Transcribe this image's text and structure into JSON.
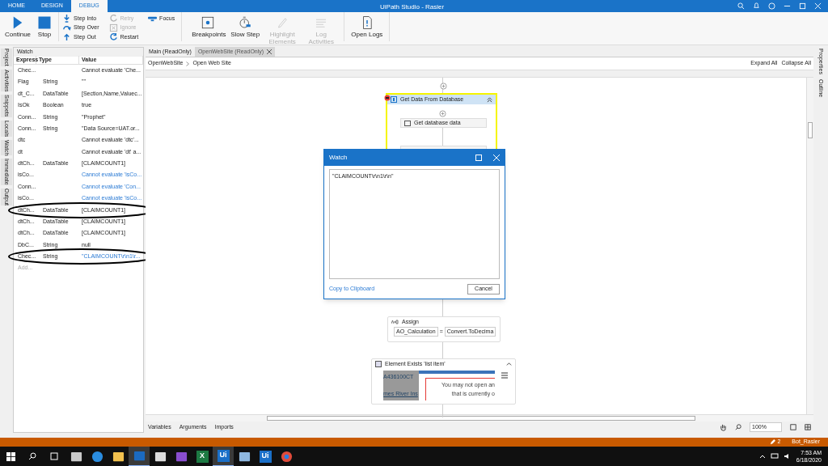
{
  "window": {
    "title": "UiPath Studio - Rasier"
  },
  "ribbon_tabs": [
    {
      "label": "HOME",
      "selected": false
    },
    {
      "label": "DESIGN",
      "selected": false
    },
    {
      "label": "DEBUG",
      "selected": true
    }
  ],
  "ribbon": {
    "large_left": [
      {
        "kind": "play",
        "label": "Continue",
        "disabled": false
      },
      {
        "kind": "stop",
        "label": "Stop",
        "disabled": false
      }
    ],
    "small": [
      {
        "kind": "step-into",
        "label": "Step Into",
        "disabled": false
      },
      {
        "kind": "step-over",
        "label": "Step Over",
        "disabled": false
      },
      {
        "kind": "step-out",
        "label": "Step Out",
        "disabled": false
      },
      {
        "kind": "retry",
        "label": "Retry",
        "disabled": true
      },
      {
        "kind": "ignore",
        "label": "Ignore",
        "disabled": true
      },
      {
        "kind": "restart",
        "label": "Restart",
        "disabled": false
      },
      {
        "kind": "focus",
        "label": "Focus",
        "disabled": false
      }
    ],
    "large_right": [
      {
        "kind": "breakpoints",
        "label": "Breakpoints",
        "disabled": false
      },
      {
        "kind": "slow",
        "label": "Slow Step",
        "disabled": false
      },
      {
        "kind": "highlight",
        "label": "Highlight Elements",
        "disabled": true
      },
      {
        "kind": "log",
        "label": "Log Activities",
        "disabled": true
      },
      {
        "kind": "logs",
        "label": "Open Logs",
        "disabled": false
      }
    ]
  },
  "left_strip": [
    "Project",
    "Activities",
    "Snippets",
    "Locals",
    "Watch",
    "Immediate",
    "Output"
  ],
  "watch": {
    "title": "Watch",
    "columns": [
      "Express",
      "Type",
      "Value"
    ],
    "rows": [
      {
        "expression": "Chec...",
        "type": "",
        "value": "Cannot evaluate 'Che...",
        "link": false,
        "circled": false
      },
      {
        "expression": "Flag",
        "type": "String",
        "value": "\"\"",
        "link": false,
        "circled": false
      },
      {
        "expression": "dt_C...",
        "type": "DataTable",
        "value": "[Section,Name,Valuec...",
        "link": false,
        "circled": false
      },
      {
        "expression": "IsOk",
        "type": "Boolean",
        "value": "true",
        "link": false,
        "circled": false
      },
      {
        "expression": "Conn...",
        "type": "String",
        "value": "\"Prophet\"",
        "link": false,
        "circled": false
      },
      {
        "expression": "Conn...",
        "type": "String",
        "value": "\"Data Source=UAT.or...",
        "link": false,
        "circled": false
      },
      {
        "expression": "dtc",
        "type": "",
        "value": "Cannot evaluate 'dtc'...",
        "link": false,
        "circled": false
      },
      {
        "expression": "dt",
        "type": "",
        "value": "Cannot evaluate 'dt' a...",
        "link": false,
        "circled": false
      },
      {
        "expression": "dtCh...",
        "type": "DataTable",
        "value": "[CLAIMCOUNT1]",
        "link": false,
        "circled": false
      },
      {
        "expression": "isCo...",
        "type": "",
        "value": "Cannot evaluate 'isCo...",
        "link": true,
        "circled": false
      },
      {
        "expression": "Conn...",
        "type": "",
        "value": "Cannot evaluate 'Con...",
        "link": true,
        "circled": false
      },
      {
        "expression": "isCo...",
        "type": "",
        "value": "Cannot evaluate 'isCo...",
        "link": true,
        "circled": false
      },
      {
        "expression": "dtCh...",
        "type": "DataTable",
        "value": "[CLAIMCOUNT1]",
        "link": false,
        "circled": true
      },
      {
        "expression": "dtCh...",
        "type": "DataTable",
        "value": "[CLAIMCOUNT1]",
        "link": false,
        "circled": false
      },
      {
        "expression": "dtCh...",
        "type": "DataTable",
        "value": "[CLAIMCOUNT1]",
        "link": false,
        "circled": false
      },
      {
        "expression": "DbC...",
        "type": "String",
        "value": "null",
        "link": false,
        "circled": false
      },
      {
        "expression": "Chec...",
        "type": "String",
        "value": "\"CLAIMCOUNT\\r\\n1\\r...",
        "link": true,
        "circled": true
      }
    ],
    "add_placeholder": "Add..."
  },
  "doc_tabs": [
    {
      "label": "Main (ReadOnly)",
      "selected": false
    },
    {
      "label": "OpenWebSite (ReadOnly)",
      "selected": true
    }
  ],
  "breadcrumb": [
    "OpenWebSite",
    "Open Web Site"
  ],
  "expand_all": "Expand All",
  "collapse_all": "Collapse All",
  "workflow": {
    "sequence_title": "Get Data From Database",
    "inner_activity": "Get database data",
    "assign": {
      "title": "Assign",
      "to": "AO_Calculation",
      "op": "=",
      "value": "Convert.ToDecima"
    },
    "element_exists": {
      "title": "Element Exists 'list item'",
      "screenshot_texts": [
        "A436100CT",
        "mes River Ins",
        "You may not open an",
        "that is currently o"
      ]
    }
  },
  "dialog": {
    "title": "Watch",
    "value": "\"CLAIMCOUNT\\r\\n1\\r\\n\"",
    "copy_link": "Copy to Clipboard",
    "cancel": "Cancel"
  },
  "right_strip": [
    "Properties",
    "Outline"
  ],
  "bottom_tabs": [
    "Variables",
    "Arguments",
    "Imports"
  ],
  "zoom": "100%",
  "status": {
    "count": "2",
    "robot": "Bot_Rasier"
  },
  "taskbar": {
    "apps": [
      {
        "kind": "files-cabinet",
        "active": false
      },
      {
        "kind": "edge",
        "active": false
      },
      {
        "kind": "folder",
        "active": false
      },
      {
        "kind": "outlook",
        "active": true
      },
      {
        "kind": "archive",
        "active": false
      },
      {
        "kind": "vs",
        "active": false
      },
      {
        "kind": "excel",
        "label": "X",
        "active": false
      },
      {
        "kind": "ui",
        "label": "Ui",
        "active": true
      },
      {
        "kind": "notepad",
        "active": false
      },
      {
        "kind": "ui",
        "label": "Ui",
        "active": false
      },
      {
        "kind": "chrome",
        "active": false
      }
    ],
    "time": "7:53 AM",
    "date": "6/18/2020"
  }
}
